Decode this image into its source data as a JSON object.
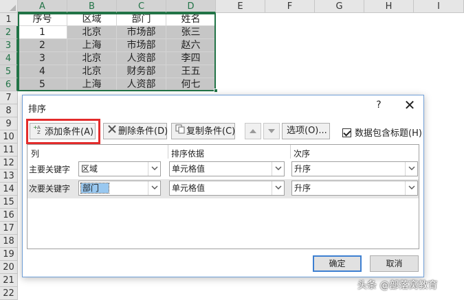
{
  "spreadsheet": {
    "columns": [
      "A",
      "B",
      "C",
      "D",
      "E",
      "F",
      "G",
      "H",
      "I"
    ],
    "rows": [
      "1",
      "2",
      "3",
      "4",
      "5",
      "6",
      "7",
      "8",
      "9",
      "10",
      "11",
      "12",
      "13",
      "14",
      "15",
      "16",
      "17",
      "18",
      "19",
      "20",
      "21",
      "22"
    ],
    "header": [
      "序号",
      "区域",
      "部门",
      "姓名"
    ],
    "data": [
      [
        "1",
        "北京",
        "市场部",
        "张三"
      ],
      [
        "2",
        "上海",
        "市场部",
        "赵六"
      ],
      [
        "3",
        "北京",
        "人资部",
        "李四"
      ],
      [
        "4",
        "北京",
        "财务部",
        "王五"
      ],
      [
        "5",
        "上海",
        "人资部",
        "何七"
      ]
    ]
  },
  "dialog": {
    "title": "排序",
    "help": "?",
    "close": "✕",
    "toolbar": {
      "add_label": "添加条件(A)",
      "delete_label": "删除条件(D)",
      "copy_label": "复制条件(C)",
      "options_label": "选项(O)...",
      "has_header_label": "数据包含标题(H)",
      "has_header_checked": true
    },
    "columns": {
      "col_label": "列",
      "sort_on_label": "排序依据",
      "order_label": "次序"
    },
    "levels": [
      {
        "label": "主要关键字",
        "column": "区域",
        "sort_on": "单元格值",
        "order": "升序"
      },
      {
        "label": "次要关键字",
        "column": "部门",
        "sort_on": "单元格值",
        "order": "升序"
      }
    ],
    "ok_label": "确定",
    "cancel_label": "取消"
  },
  "watermark": "头条 @部落窝教育",
  "colors": {
    "selection_border": "#217346",
    "highlight_box": "#e32b2b",
    "dialog_border": "#6f9ed6"
  }
}
